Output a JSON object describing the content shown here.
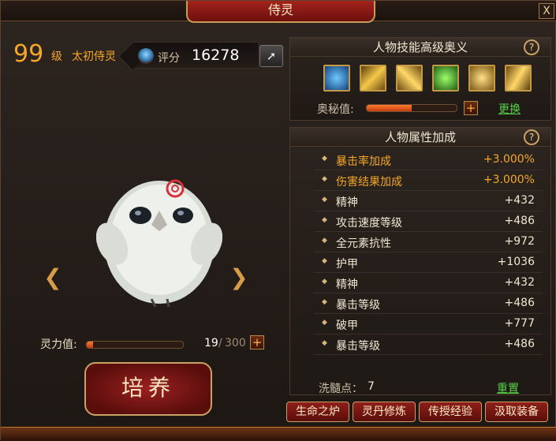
{
  "window": {
    "title": "侍灵",
    "close": "X"
  },
  "pet": {
    "level": "99",
    "level_unit": "级",
    "name": "太初侍灵"
  },
  "score": {
    "label": "评分",
    "value": "16278"
  },
  "spirit": {
    "label": "灵力值:",
    "current": "19",
    "sep": "/",
    "max": "300",
    "fraction": 0.063
  },
  "cultivate": {
    "label": "培养"
  },
  "skills_panel": {
    "title": "人物技能高级奥义",
    "help": "?",
    "skills": [
      {
        "icon": "blue-running-figure-icon"
      },
      {
        "icon": "gold-slash-icon"
      },
      {
        "icon": "gold-blades-icon"
      },
      {
        "icon": "green-figure-icon"
      },
      {
        "icon": "gold-burst-icon"
      },
      {
        "icon": "gold-strike-icon"
      }
    ],
    "arcane_label": "奥秘值:",
    "arcane_fraction": 0.5,
    "change_link": "更换"
  },
  "attr_panel": {
    "title": "人物属性加成",
    "help": "?",
    "rows": [
      {
        "name": "暴击率加成",
        "value": "+3.000%",
        "highlight": true
      },
      {
        "name": "伤害结果加成",
        "value": "+3.000%",
        "highlight": true
      },
      {
        "name": "精神",
        "value": "+432",
        "highlight": false
      },
      {
        "name": "攻击速度等级",
        "value": "+486",
        "highlight": false
      },
      {
        "name": "全元素抗性",
        "value": "+972",
        "highlight": false
      },
      {
        "name": "护甲",
        "value": "+1036",
        "highlight": false
      },
      {
        "name": "精神",
        "value": "+432",
        "highlight": false
      },
      {
        "name": "暴击等级",
        "value": "+486",
        "highlight": false
      },
      {
        "name": "破甲",
        "value": "+777",
        "highlight": false
      },
      {
        "name": "暴击等级",
        "value": "+486",
        "highlight": false
      }
    ],
    "wash_label": "洗髓点：",
    "wash_value": "7",
    "reset_link": "重置"
  },
  "bottom_buttons": [
    "生命之炉",
    "灵丹修炼",
    "传授经验",
    "汲取装备"
  ],
  "colors": {
    "accent": "#f5a72a",
    "link": "#56d04a",
    "button_red": "#8e1f19"
  }
}
